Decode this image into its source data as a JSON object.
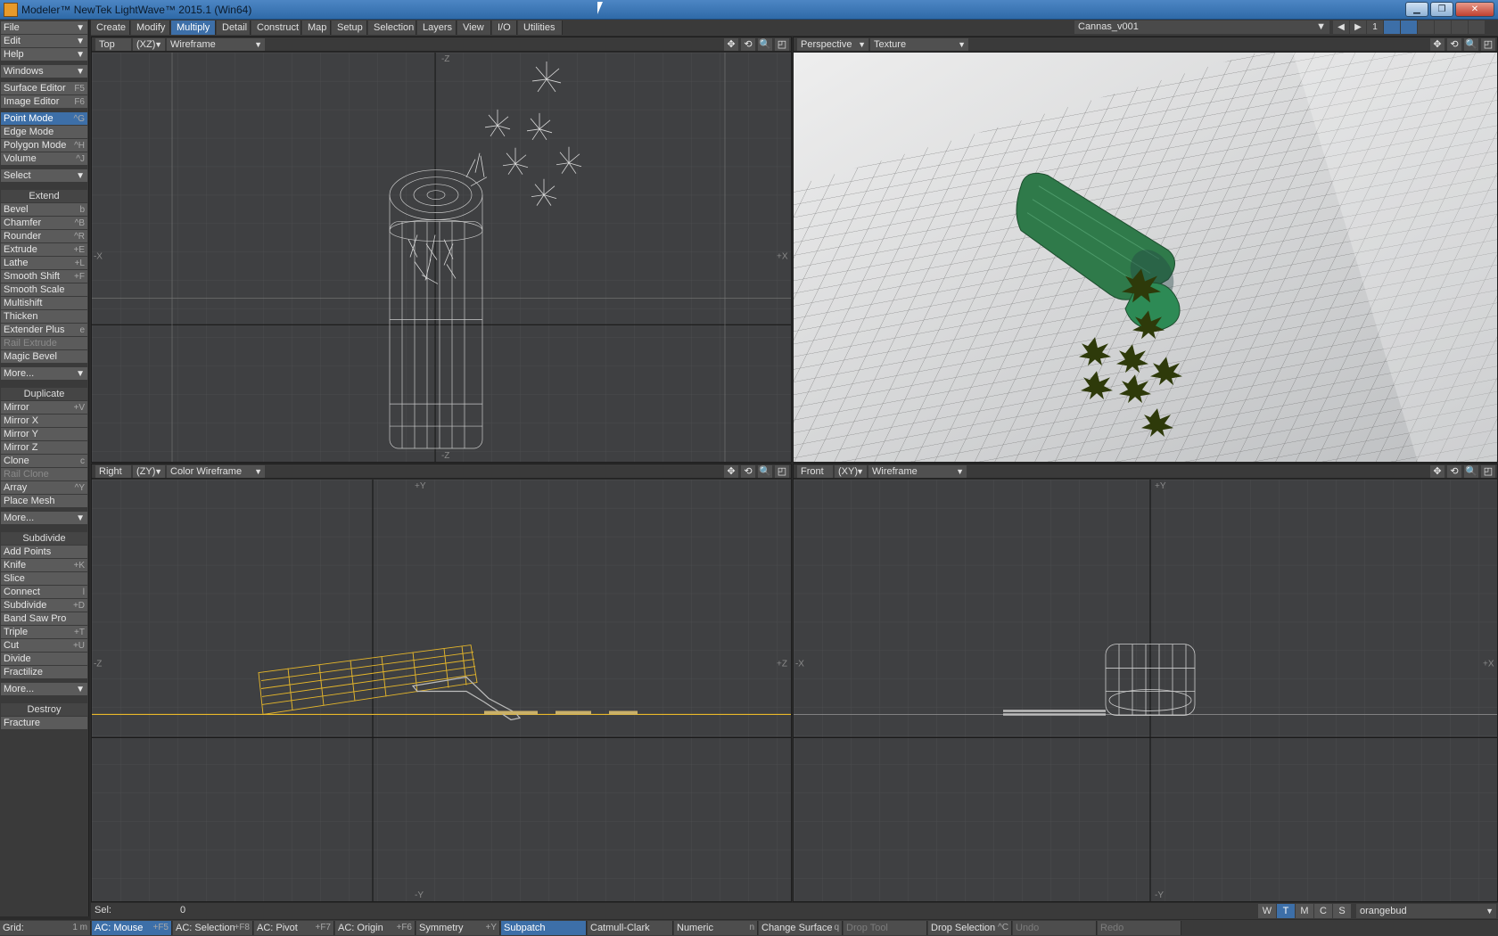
{
  "window": {
    "title": "Modeler™ NewTek LightWave™ 2015.1 (Win64)",
    "buttons": {
      "minimize": "▁",
      "maximize": "❐",
      "close": "✕"
    }
  },
  "menus": [
    {
      "label": "File",
      "sc": "▼"
    },
    {
      "label": "Edit",
      "sc": "▼"
    },
    {
      "label": "Help",
      "sc": "▼"
    }
  ],
  "windows_btn": {
    "label": "Windows",
    "sc": "▼"
  },
  "editors": [
    {
      "label": "Surface Editor",
      "sc": "F5"
    },
    {
      "label": "Image Editor",
      "sc": "F6"
    }
  ],
  "modes": [
    {
      "label": "Point Mode",
      "sc": "^G",
      "active": true
    },
    {
      "label": "Edge Mode",
      "sc": ""
    },
    {
      "label": "Polygon Mode",
      "sc": "^H"
    },
    {
      "label": "Volume",
      "sc": "^J"
    }
  ],
  "select_btn": {
    "label": "Select",
    "sc": "▼"
  },
  "extend": {
    "title": "Extend",
    "items": [
      {
        "label": "Bevel",
        "sc": "b"
      },
      {
        "label": "Chamfer",
        "sc": "^B"
      },
      {
        "label": "Rounder",
        "sc": "^R"
      },
      {
        "label": "Extrude",
        "sc": "+E"
      },
      {
        "label": "Lathe",
        "sc": "+L"
      },
      {
        "label": "Smooth Shift",
        "sc": "+F"
      },
      {
        "label": "Smooth Scale",
        "sc": ""
      },
      {
        "label": "Multishift",
        "sc": ""
      },
      {
        "label": "Thicken",
        "sc": ""
      },
      {
        "label": "Extender Plus",
        "sc": "e"
      },
      {
        "label": "Rail Extrude",
        "sc": "",
        "disabled": true
      },
      {
        "label": "Magic Bevel",
        "sc": ""
      },
      {
        "label": "More...",
        "sc": "▼"
      }
    ]
  },
  "duplicate": {
    "title": "Duplicate",
    "items": [
      {
        "label": "Mirror",
        "sc": "+V"
      },
      {
        "label": "Mirror X",
        "sc": ""
      },
      {
        "label": "Mirror Y",
        "sc": ""
      },
      {
        "label": "Mirror Z",
        "sc": ""
      },
      {
        "label": "Clone",
        "sc": "c"
      },
      {
        "label": "Rail Clone",
        "sc": "",
        "disabled": true
      },
      {
        "label": "Array",
        "sc": "^Y"
      },
      {
        "label": "Place Mesh",
        "sc": ""
      },
      {
        "label": "More...",
        "sc": "▼"
      }
    ]
  },
  "subdivide": {
    "title": "Subdivide",
    "items": [
      {
        "label": "Add Points",
        "sc": ""
      },
      {
        "label": "Knife",
        "sc": "+K"
      },
      {
        "label": "Slice",
        "sc": ""
      },
      {
        "label": "Connect",
        "sc": "l"
      },
      {
        "label": "Subdivide",
        "sc": "+D"
      },
      {
        "label": "Band Saw Pro",
        "sc": ""
      },
      {
        "label": "Triple",
        "sc": "+T"
      },
      {
        "label": "Cut",
        "sc": "+U"
      },
      {
        "label": "Divide",
        "sc": ""
      },
      {
        "label": "Fractilize",
        "sc": ""
      },
      {
        "label": "More...",
        "sc": "▼"
      }
    ]
  },
  "destroy": {
    "title": "Destroy",
    "items": [
      {
        "label": "Fracture",
        "sc": ""
      }
    ]
  },
  "tabs": [
    {
      "label": "Create"
    },
    {
      "label": "Modify"
    },
    {
      "label": "Multiply",
      "active": true
    },
    {
      "label": "Detail"
    },
    {
      "label": "Construct"
    },
    {
      "label": "Map"
    },
    {
      "label": "Setup"
    },
    {
      "label": "Selection"
    },
    {
      "label": "Layers"
    },
    {
      "label": "View"
    },
    {
      "label": "I/O"
    },
    {
      "label": "Utilities"
    }
  ],
  "layer": {
    "object": "Cannas_v001",
    "arrow": "▼",
    "prev": "◀",
    "next": "▶",
    "number": "1"
  },
  "viewports": {
    "top": {
      "view": "Top",
      "axis": "(XZ)",
      "mode": "Wireframe",
      "arrow": "▼",
      "labels": {
        "up": "-Z",
        "down": "-Z",
        "left": "-X",
        "right": "+X"
      }
    },
    "persp": {
      "view": "Perspective",
      "mode": "Texture",
      "arrow": "▼"
    },
    "right": {
      "view": "Right",
      "axis": "(ZY)",
      "mode": "Color Wireframe",
      "arrow": "▼",
      "labels": {
        "up": "+Y",
        "down": "-Y",
        "left": "-Z",
        "right": "+Z"
      }
    },
    "front": {
      "view": "Front",
      "axis": "(XY)",
      "mode": "Wireframe",
      "arrow": "▼",
      "labels": {
        "up": "+Y",
        "down": "-Y",
        "left": "-X",
        "right": "+X"
      }
    }
  },
  "vp_icons": {
    "move": "✥",
    "rotate": "⟲",
    "zoom": "🔍",
    "max": "◰"
  },
  "sel": {
    "label": "Sel:",
    "value": "0"
  },
  "wtmcs": [
    {
      "label": "W"
    },
    {
      "label": "T",
      "active": true
    },
    {
      "label": "M"
    },
    {
      "label": "C"
    },
    {
      "label": "S"
    }
  ],
  "surface": {
    "name": "orangebud",
    "arrow": "▼"
  },
  "status": [
    {
      "label": "Grid:",
      "value": "1 m"
    },
    {
      "label": "AC: Mouse",
      "sc": "+F5",
      "active": true
    },
    {
      "label": "AC: Selection",
      "sc": "+F8"
    },
    {
      "label": "AC: Pivot",
      "sc": "+F7"
    },
    {
      "label": "AC: Origin",
      "sc": "+F6"
    },
    {
      "label": "Symmetry",
      "sc": "+Y"
    },
    {
      "label": "Subpatch",
      "sc": "",
      "active": true
    },
    {
      "label": "Catmull-Clark",
      "sc": ""
    },
    {
      "label": "Numeric",
      "sc": "n"
    },
    {
      "label": "Change Surface",
      "sc": "q"
    },
    {
      "label": "Drop Tool",
      "sc": "",
      "disabled": true
    },
    {
      "label": "Drop Selection",
      "sc": "^C"
    },
    {
      "label": "Undo",
      "sc": "",
      "disabled": true
    },
    {
      "label": "Redo",
      "sc": "",
      "disabled": true
    }
  ],
  "colors": {
    "accent": "#3d6fa8",
    "selected_mesh": "#e8b82a",
    "wire": "#cfcfcf",
    "bottle": "#2f7a4a",
    "leaf": "#3a4a10"
  }
}
